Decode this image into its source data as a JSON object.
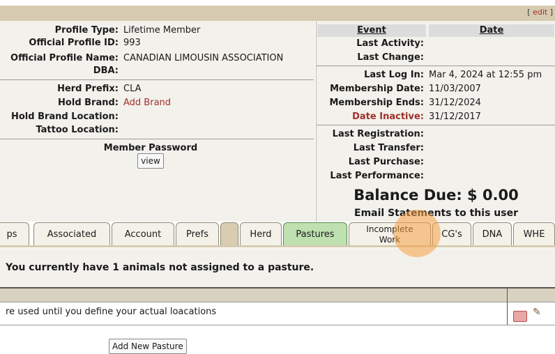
{
  "header": {
    "edit_link": "edit"
  },
  "profile": {
    "profile_type_label": "Profile Type:",
    "profile_type_value": "Lifetime Member",
    "official_id_label": "Official Profile ID:",
    "official_id_value": "993",
    "official_name_label": "Official Profile Name:",
    "official_name_value": "CANADIAN LIMOUSIN ASSOCIATION",
    "dba_label": "DBA:",
    "herd_prefix_label": "Herd Prefix:",
    "herd_prefix_value": "CLA",
    "hold_brand_label": "Hold Brand:",
    "hold_brand_value": "Add Brand",
    "hold_brand_location_label": "Hold Brand Location:",
    "tattoo_location_label": "Tattoo Location:",
    "member_password_label": "Member Password",
    "view_button": "view"
  },
  "events": {
    "event_header": "Event",
    "date_header": "Date",
    "last_activity_label": "Last Activity:",
    "last_change_label": "Last Change:",
    "last_login_label": "Last Log In:",
    "last_login_value": "Mar 4, 2024 at 12:55 pm",
    "membership_date_label": "Membership Date:",
    "membership_date_value": "11/03/2007",
    "membership_ends_label": "Membership Ends:",
    "membership_ends_value": "31/12/2024",
    "date_inactive_label": "Date Inactive:",
    "date_inactive_value": "31/12/2017",
    "last_registration_label": "Last Registration:",
    "last_transfer_label": "Last Transfer:",
    "last_purchase_label": "Last Purchase:",
    "last_performance_label": "Last Performance:",
    "balance_due": "Balance Due: $ 0.00",
    "email_statements": "Email Statements to this user"
  },
  "tabs": {
    "t0": "ps",
    "t1": "Associated",
    "t2": "Account",
    "t3": "Prefs",
    "t5": "Herd",
    "t6": "Pastures",
    "t7_line1": "Incomplete",
    "t7_line2": "Work",
    "t8": "CG's",
    "t9": "DNA",
    "t10": "WHE"
  },
  "pastures": {
    "notice": "You currently have 1 animals not assigned to a pasture.",
    "row_text": "re used until you define your actual loacations",
    "add_button": "Add New Pasture"
  },
  "colors": {
    "active_tab": "#bfe0b0",
    "accent_red": "#a0302a",
    "header_band": "#d6cbb0"
  }
}
